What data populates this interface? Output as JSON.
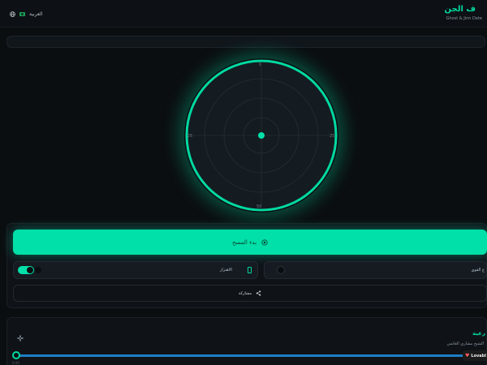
{
  "header": {
    "title": "ف الجن",
    "subtitle": "Ghost & Jinn Dete",
    "language_label": "العربية"
  },
  "radar": {
    "axis_labels": {
      "top": "0",
      "right": "25",
      "bottom": "50",
      "left": "-25"
    },
    "accent": "#00d9a0"
  },
  "controls": {
    "scan_button_label": "بدء المسح",
    "vibration_label": "الاهتزاز",
    "realtime_label": "ع القوي",
    "share_label": "مشاركة"
  },
  "card": {
    "title": "رعية",
    "subtitle": "الشبح مشاري العاشي",
    "slider_min": "0.00",
    "slider_value": 0.0
  },
  "badge": {
    "label": "Lovabl"
  },
  "colors": {
    "accent": "#00d9a0",
    "button": "#00e0a8",
    "slider": "#1d7ec4",
    "background": "#0b0e11"
  },
  "icons": {
    "language": "globe-icon",
    "flag": "flag-icon",
    "scan": "scan-icon",
    "vibration": "phone-icon",
    "share": "share-icon",
    "settings": "sparkle-icon"
  }
}
